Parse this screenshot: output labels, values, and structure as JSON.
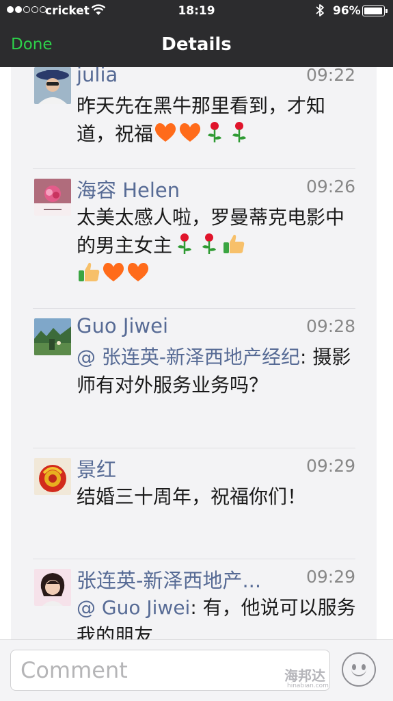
{
  "status_bar": {
    "signal_dots_filled": 2,
    "signal_dots_total": 5,
    "carrier": "cricket",
    "time": "18:19",
    "battery_pct": "96%",
    "battery_level": 0.96,
    "icons": [
      "wifi-icon",
      "bluetooth-icon",
      "battery-icon"
    ]
  },
  "nav": {
    "done_label": "Done",
    "title": "Details"
  },
  "comments": [
    {
      "name": "julia",
      "time": "09:22",
      "text": "昨天先在黑牛那里看到，才知道，祝福",
      "emojis": [
        "heart",
        "heart",
        "rose",
        "rose"
      ]
    },
    {
      "name": "海容 Helen",
      "time": "09:26",
      "text": "太美太感人啦，罗曼蒂克电影中的男主女主",
      "emojis": [
        "rose",
        "rose",
        "thumbs-up",
        "thumbs-up",
        "heart",
        "heart"
      ]
    },
    {
      "name": "Guo Jiwei",
      "time": "09:28",
      "mention": "@ 张连英-新泽西地产经纪",
      "text": ": 摄影师有对外服务业务吗？"
    },
    {
      "name": "景红",
      "time": "09:29",
      "text": "结婚三十周年，祝福你们！"
    },
    {
      "name": "张连英-新泽西地产...",
      "time": "09:29",
      "mention": "@ Guo Jiwei",
      "text": ": 有，他说可以服务我的朋友"
    }
  ],
  "composer": {
    "placeholder": "Comment"
  },
  "watermark": {
    "text": "海邦达",
    "sub": "hinabian.com"
  },
  "colors": {
    "nav_bg": "#2c2c2e",
    "done": "#2dd24a",
    "name": "#576b95",
    "panel": "#f3f3f5"
  }
}
